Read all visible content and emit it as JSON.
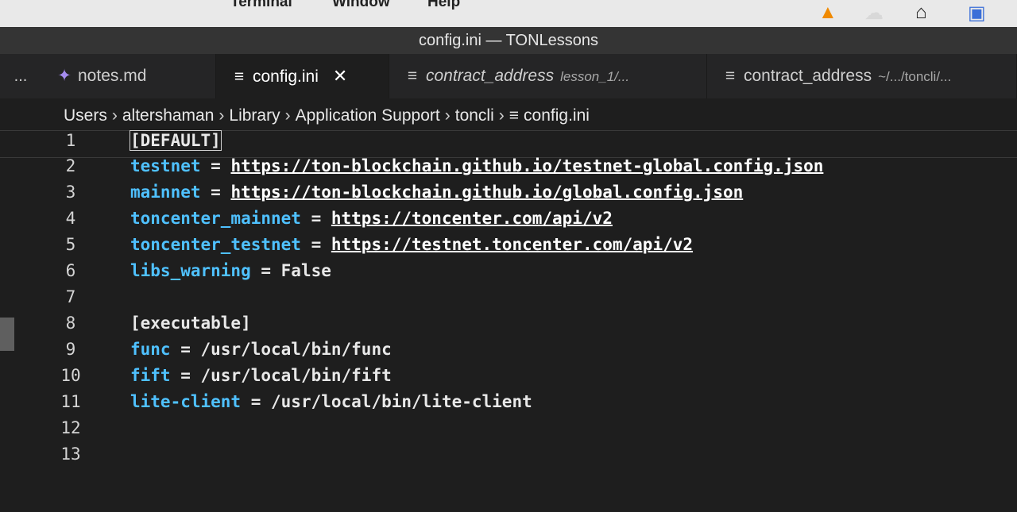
{
  "menubar": {
    "items": [
      "Terminal",
      "Window",
      "Help"
    ],
    "status_icons": [
      "vlc-icon",
      "cloud-icon",
      "home-icon",
      "translate-icon"
    ]
  },
  "window": {
    "title": "config.ini — TONLessons"
  },
  "tabs": [
    {
      "name": "notes.md",
      "icon": "notes-icon",
      "desc": "",
      "active": false,
      "italic": false
    },
    {
      "name": "config.ini",
      "icon": "file-lines-icon",
      "desc": "",
      "active": true,
      "italic": false,
      "close": "✕"
    },
    {
      "name": "contract_address",
      "icon": "file-lines-icon",
      "desc": "lesson_1/...",
      "active": false,
      "italic": true
    },
    {
      "name": "contract_address",
      "icon": "file-lines-icon",
      "desc": "~/.../toncli/...",
      "active": false,
      "italic": false
    }
  ],
  "tab_overflow": "...",
  "breadcrumb": [
    "Users",
    "altershaman",
    "Library",
    "Application Support",
    "toncli",
    "config.ini"
  ],
  "editor": {
    "lines": [
      {
        "n": "1",
        "key": "",
        "eq": "",
        "value": "",
        "raw": "[DEFAULT]",
        "url": false
      },
      {
        "n": "2",
        "key": "testnet",
        "eq": " = ",
        "value": "https://ton-blockchain.github.io/testnet-global.config.json",
        "raw": "",
        "url": true
      },
      {
        "n": "3",
        "key": "mainnet",
        "eq": " = ",
        "value": "https://ton-blockchain.github.io/global.config.json",
        "raw": "",
        "url": true
      },
      {
        "n": "4",
        "key": "toncenter_mainnet",
        "eq": " = ",
        "value": "https://toncenter.com/api/v2",
        "raw": "",
        "url": true
      },
      {
        "n": "5",
        "key": "toncenter_testnet",
        "eq": " = ",
        "value": "https://testnet.toncenter.com/api/v2",
        "raw": "",
        "url": true
      },
      {
        "n": "6",
        "key": "libs_warning",
        "eq": " = ",
        "value": "False",
        "raw": "",
        "url": false
      },
      {
        "n": "7",
        "key": "",
        "eq": "",
        "value": "",
        "raw": "",
        "url": false
      },
      {
        "n": "8",
        "key": "",
        "eq": "",
        "value": "",
        "raw": "[executable]",
        "url": false
      },
      {
        "n": "9",
        "key": "func",
        "eq": " = ",
        "value": "/usr/local/bin/func",
        "raw": "",
        "url": false
      },
      {
        "n": "10",
        "key": "fift",
        "eq": " = ",
        "value": "/usr/local/bin/fift",
        "raw": "",
        "url": false
      },
      {
        "n": "11",
        "key": "lite-client",
        "eq": " = ",
        "value": "/usr/local/bin/lite-client",
        "raw": "",
        "url": false
      },
      {
        "n": "12",
        "key": "",
        "eq": "",
        "value": "",
        "raw": "",
        "url": false
      },
      {
        "n": "13",
        "key": "",
        "eq": "",
        "value": "",
        "raw": "",
        "url": false
      }
    ]
  }
}
